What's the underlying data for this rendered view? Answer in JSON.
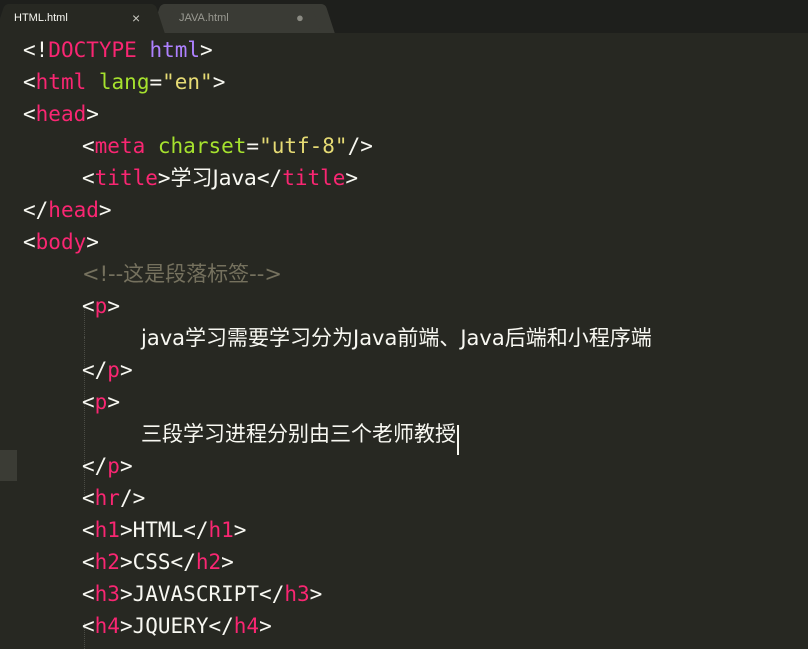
{
  "tabs": [
    {
      "label": "HTML.html",
      "control": "×",
      "active": true
    },
    {
      "label": "JAVA.html",
      "control": "●",
      "active": false
    }
  ],
  "theme": {
    "background": "#272822",
    "tag": "#f92672",
    "attribute": "#a6e22e",
    "string": "#e6db74",
    "comment": "#75715e",
    "text": "#f8f8f2"
  },
  "code": {
    "l1": {
      "p1": "<!",
      "doctype": "DOCTYPE",
      "sp": " ",
      "html": "html",
      "p2": ">"
    },
    "l2": {
      "p1": "<",
      "tag": "html",
      "sp": " ",
      "attr": "lang",
      "eq": "=",
      "val": "\"en\"",
      "p2": ">"
    },
    "l3": {
      "p1": "<",
      "tag": "head",
      "p2": ">"
    },
    "l4": {
      "p1": "<",
      "tag": "meta",
      "sp": " ",
      "attr": "charset",
      "eq": "=",
      "val": "\"utf-8\"",
      "p2": "/>"
    },
    "l5": {
      "p1": "<",
      "tag": "title",
      "p2": ">",
      "text": "学习Java",
      "p3": "</",
      "tag2": "title",
      "p4": ">"
    },
    "l6": {
      "p1": "</",
      "tag": "head",
      "p2": ">"
    },
    "l7": {
      "p1": "<",
      "tag": "body",
      "p2": ">"
    },
    "l8": {
      "comment": "<!--这是段落标签-->"
    },
    "l9": {
      "p1": "<",
      "tag": "p",
      "p2": ">"
    },
    "l10": {
      "text": "java学习需要学习分为Java前端、Java后端和小程序端"
    },
    "l11": {
      "p1": "</",
      "tag": "p",
      "p2": ">"
    },
    "l12": {
      "p1": "<",
      "tag": "p",
      "p2": ">"
    },
    "l13": {
      "text": "三段学习进程分别由三个老师教授"
    },
    "l14": {
      "p1": "</",
      "tag": "p",
      "p2": ">"
    },
    "l15": {
      "p1": "<",
      "tag": "hr",
      "p2": "/>"
    },
    "l16": {
      "p1": "<",
      "tag": "h1",
      "p2": ">",
      "text": "HTML",
      "p3": "</",
      "tag2": "h1",
      "p4": ">"
    },
    "l17": {
      "p1": "<",
      "tag": "h2",
      "p2": ">",
      "text": "CSS",
      "p3": "</",
      "tag2": "h2",
      "p4": ">"
    },
    "l18": {
      "p1": "<",
      "tag": "h3",
      "p2": ">",
      "text": "JAVASCRIPT",
      "p3": "</",
      "tag2": "h3",
      "p4": ">"
    },
    "l19": {
      "p1": "<",
      "tag": "h4",
      "p2": ">",
      "text": "JQUERY",
      "p3": "</",
      "tag2": "h4",
      "p4": ">"
    }
  }
}
